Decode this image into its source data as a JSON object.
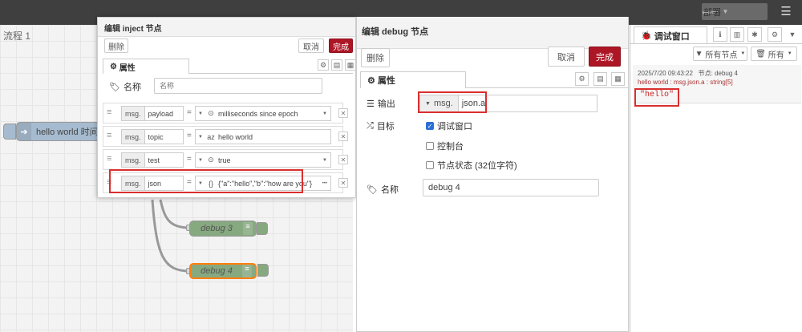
{
  "header": {
    "deploy_label": "部署",
    "deploy_icon": "deploy-icon",
    "menu_icon": "hamburger-menu-icon"
  },
  "workspace": {
    "flow_tab": "流程 1",
    "inject_node_label": "hello world 时间戳",
    "debug3_label": "debug 3",
    "debug4_label": "debug 4"
  },
  "inject_editor": {
    "title": "编辑 inject 节点",
    "delete": "删除",
    "cancel": "取消",
    "done": "完成",
    "tab": "属性",
    "name_label": "名称",
    "name_placeholder": "名称",
    "props": [
      {
        "prefix": "msg.",
        "key": "payload",
        "type_icon": "⊙",
        "value": "milliseconds since epoch"
      },
      {
        "prefix": "msg.",
        "key": "topic",
        "type_icon": "az",
        "value": "hello world"
      },
      {
        "prefix": "msg.",
        "key": "test",
        "type_icon": "⊙",
        "value": "true"
      },
      {
        "prefix": "msg.",
        "key": "json",
        "type_icon": "{}",
        "value": "{\"a\":\"hello\",\"b\":\"how are you\"}"
      }
    ]
  },
  "debug_editor": {
    "title": "编辑 debug 节点",
    "delete": "删除",
    "cancel": "取消",
    "done": "完成",
    "tab": "属性",
    "output_label": "输出",
    "output_prefix": "msg.",
    "output_value": "json.a",
    "target_label": "目标",
    "opt_debug": "调试窗口",
    "opt_console": "控制台",
    "opt_status": "节点状态 (32位字符)",
    "name_label": "名称",
    "name_value": "debug 4"
  },
  "sidebar": {
    "tab_title": "调试窗口",
    "filter_label": "所有节点",
    "clear_label": "所有",
    "message": {
      "timestamp": "2025/7/20 09:43:22",
      "node": "节点: debug 4",
      "topic_line": "hello world : msg.json.a : string[5]",
      "value": "\"hello\""
    }
  },
  "colors": {
    "header": "#3f3f3f",
    "primary_button": "#ad1625",
    "highlight_box": "#d92f2f",
    "inject_node": "#a6bbcf",
    "debug_node": "#87a980"
  }
}
